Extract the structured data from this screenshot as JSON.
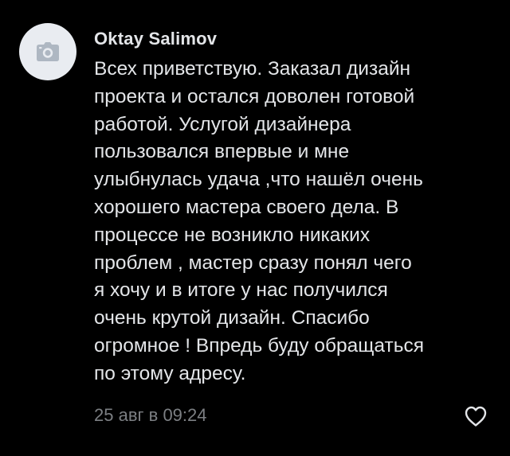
{
  "comment": {
    "author": "Oktay Salimov",
    "lines": [
      "Всех приветствую. Заказал дизайн",
      "проекта и остался доволен готовой",
      "работой. Услугой дизайнера",
      "пользовался впервые и мне",
      "улыбнулась удача ,что нашёл очень",
      "хорошего мастера своего дела. В",
      "процессе не возникло никаких",
      "проблем , мастер сразу понял чего",
      "я хочу и в итоге у нас получился",
      "очень крутой дизайн. Спасибо",
      "огромное ! Впредь буду обращаться",
      "по этому адресу."
    ],
    "date": "25 авг в 09:24",
    "avatar_icon": "camera-icon",
    "like_icon": "heart-outline-icon"
  },
  "colors": {
    "background": "#000000",
    "text": "#e3e5e8",
    "secondary_text": "#7c7f83",
    "avatar_bg": "#e9ecf1",
    "avatar_icon": "#aeb7c2"
  }
}
